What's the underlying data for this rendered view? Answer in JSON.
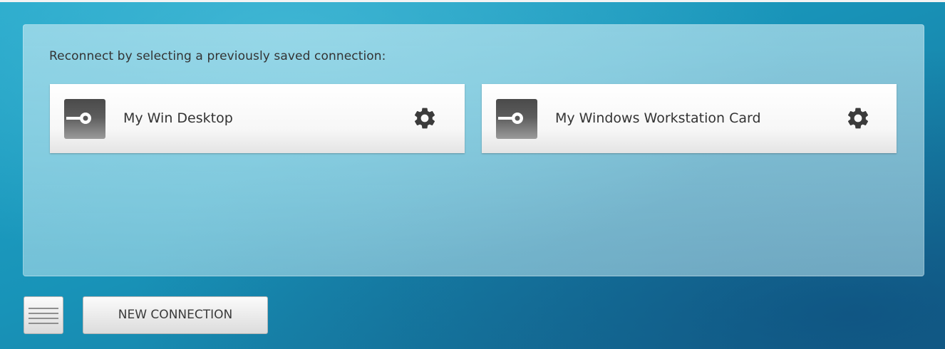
{
  "saved_connections": {
    "title": "Reconnect by selecting a previously saved connection:",
    "items": [
      {
        "label": "My Win Desktop",
        "icon": "connection-icon",
        "settings_icon": "gear-icon"
      },
      {
        "label": "My Windows Workstation Card",
        "icon": "connection-icon",
        "settings_icon": "gear-icon"
      }
    ]
  },
  "footer": {
    "menu_icon": "hamburger-menu-icon",
    "new_connection_label": "NEW CONNECTION"
  },
  "colors": {
    "background_top": "#22a6c9",
    "background_bottom": "#176f97",
    "text": "#333333",
    "icon_dark": "#4a4a4a"
  }
}
